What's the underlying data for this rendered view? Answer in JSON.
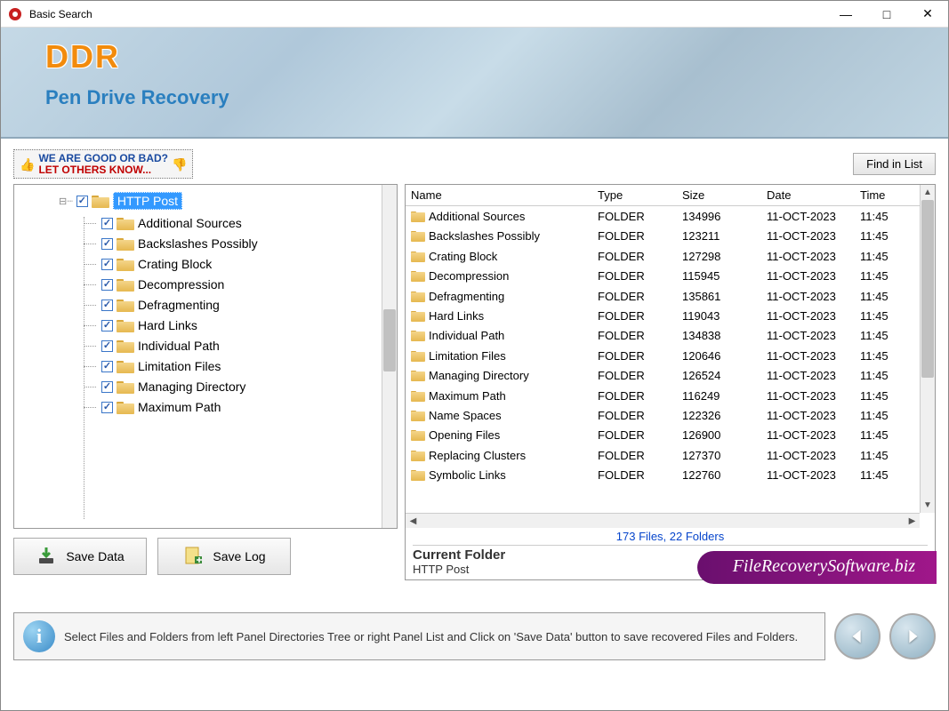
{
  "window": {
    "title": "Basic Search"
  },
  "banner": {
    "brand": "DDR",
    "sub": "Pen Drive Recovery"
  },
  "feedback": {
    "line1": "WE ARE GOOD OR BAD?",
    "line2": "LET OTHERS KNOW..."
  },
  "buttons": {
    "find": "Find in List",
    "save_data": "Save Data",
    "save_log": "Save Log"
  },
  "tree": {
    "root": "HTTP Post",
    "children": [
      "Additional Sources",
      "Backslashes Possibly",
      "Crating Block",
      "Decompression",
      "Defragmenting",
      "Hard Links",
      "Individual Path",
      "Limitation Files",
      "Managing Directory",
      "Maximum Path"
    ]
  },
  "list": {
    "columns": {
      "name": "Name",
      "type": "Type",
      "size": "Size",
      "date": "Date",
      "time": "Time"
    },
    "rows": [
      {
        "name": "Additional Sources",
        "type": "FOLDER",
        "size": "134996",
        "date": "11-OCT-2023",
        "time": "11:45"
      },
      {
        "name": "Backslashes Possibly",
        "type": "FOLDER",
        "size": "123211",
        "date": "11-OCT-2023",
        "time": "11:45"
      },
      {
        "name": "Crating Block",
        "type": "FOLDER",
        "size": "127298",
        "date": "11-OCT-2023",
        "time": "11:45"
      },
      {
        "name": "Decompression",
        "type": "FOLDER",
        "size": "115945",
        "date": "11-OCT-2023",
        "time": "11:45"
      },
      {
        "name": "Defragmenting",
        "type": "FOLDER",
        "size": "135861",
        "date": "11-OCT-2023",
        "time": "11:45"
      },
      {
        "name": "Hard Links",
        "type": "FOLDER",
        "size": "119043",
        "date": "11-OCT-2023",
        "time": "11:45"
      },
      {
        "name": "Individual Path",
        "type": "FOLDER",
        "size": "134838",
        "date": "11-OCT-2023",
        "time": "11:45"
      },
      {
        "name": "Limitation Files",
        "type": "FOLDER",
        "size": "120646",
        "date": "11-OCT-2023",
        "time": "11:45"
      },
      {
        "name": "Managing Directory",
        "type": "FOLDER",
        "size": "126524",
        "date": "11-OCT-2023",
        "time": "11:45"
      },
      {
        "name": "Maximum Path",
        "type": "FOLDER",
        "size": "116249",
        "date": "11-OCT-2023",
        "time": "11:45"
      },
      {
        "name": "Name Spaces",
        "type": "FOLDER",
        "size": "122326",
        "date": "11-OCT-2023",
        "time": "11:45"
      },
      {
        "name": "Opening Files",
        "type": "FOLDER",
        "size": "126900",
        "date": "11-OCT-2023",
        "time": "11:45"
      },
      {
        "name": "Replacing Clusters",
        "type": "FOLDER",
        "size": "127370",
        "date": "11-OCT-2023",
        "time": "11:45"
      },
      {
        "name": "Symbolic Links",
        "type": "FOLDER",
        "size": "122760",
        "date": "11-OCT-2023",
        "time": "11:45"
      }
    ]
  },
  "status": {
    "count": "173 Files, 22 Folders",
    "cur_label": "Current Folder",
    "cur_name": "HTTP Post"
  },
  "watermark": "FileRecoverySoftware.biz",
  "hint": "Select Files and Folders from left Panel Directories Tree or right Panel List and Click on 'Save Data' button to save recovered Files and Folders."
}
